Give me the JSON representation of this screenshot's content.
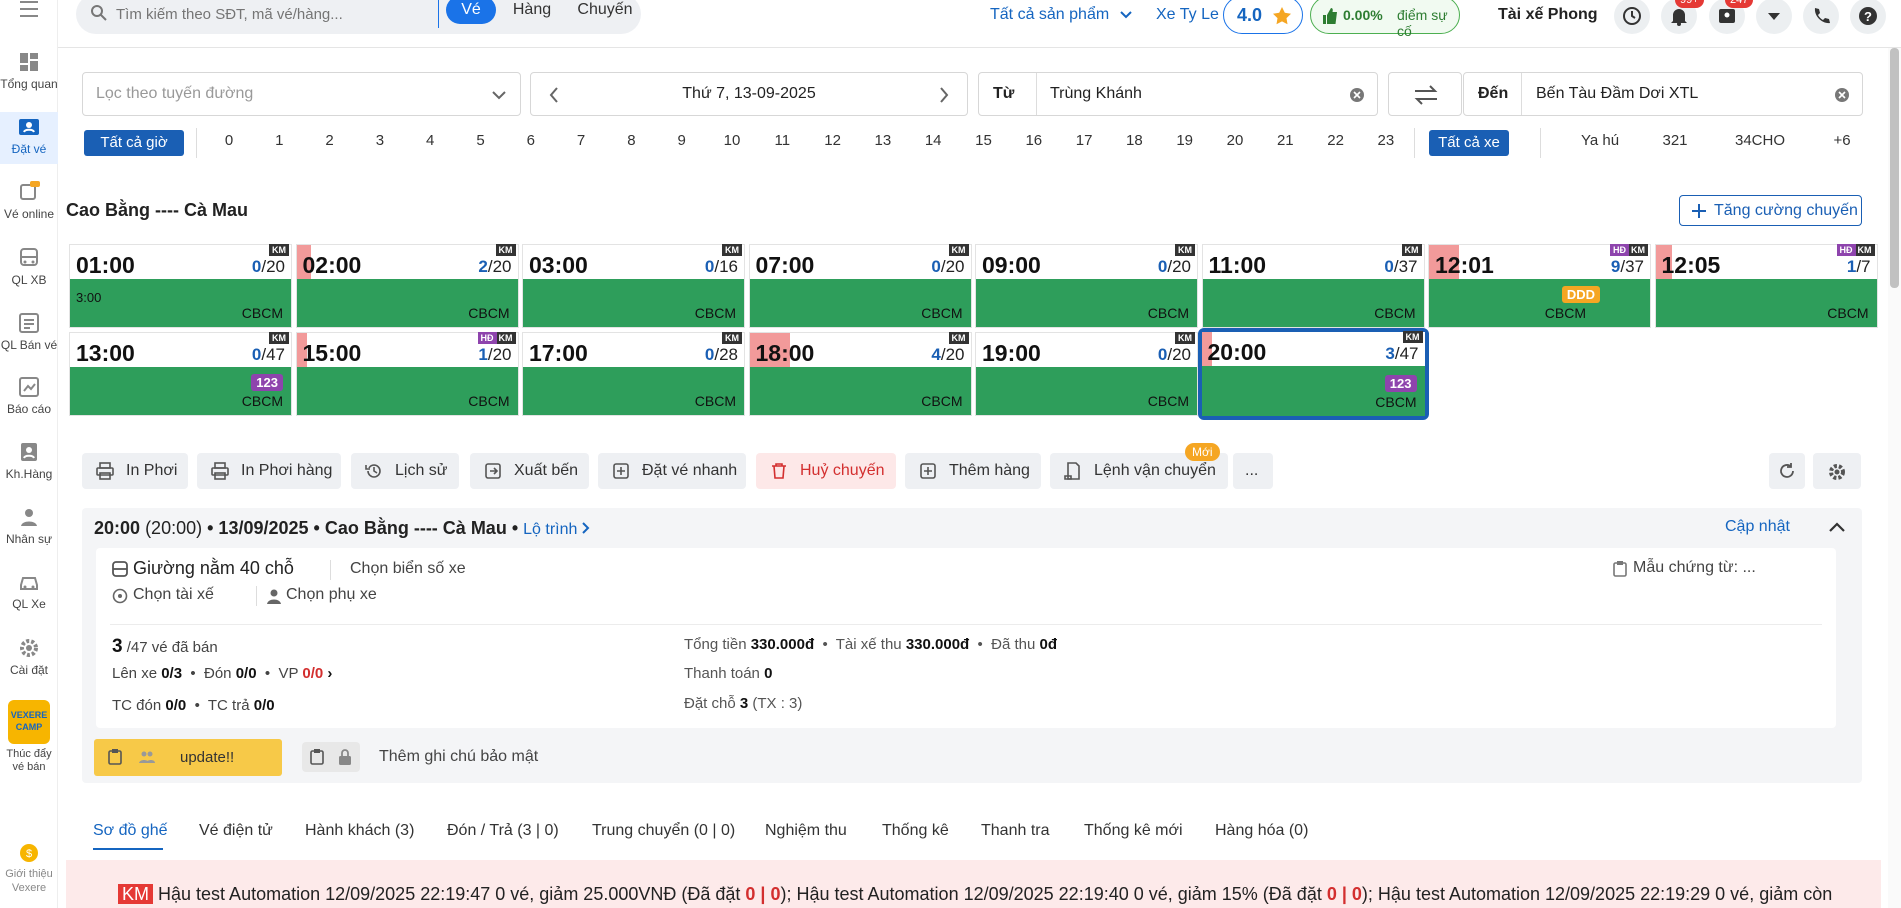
{
  "topbar": {
    "search_placeholder": "Tìm kiếm theo SĐT, mã vé/hàng...",
    "seg_tabs": [
      "Vé",
      "Hàng",
      "Chuyến"
    ],
    "products": "Tất cả sản phẩm",
    "company": "Xe Ty Le",
    "rating": "4.0",
    "incident": "0.00%",
    "incident_label": "điểm sự cố",
    "user": "Tài xế Phong",
    "notif_badge": "99+",
    "user_badge": "247"
  },
  "sidebar": {
    "items": [
      "Tổng quan",
      "Đặt vé",
      "Vé online",
      "QL XB",
      "QL Bán vé",
      "Báo cáo",
      "Kh.Hàng",
      "Nhân sự",
      "QL Xe",
      "Cài đặt",
      "Thúc đẩy vé bán",
      "Giới thiệu Vexere"
    ],
    "camp_text": "VEXERE CAMP"
  },
  "filters": {
    "route_placeholder": "Lọc theo tuyến đường",
    "date": "Thứ 7, 13-09-2025",
    "from_label": "Từ",
    "from_value": "Trùng Khánh",
    "to_label": "Đến",
    "to_value": "Bến Tàu Đầm Dơi XTL",
    "all_hours": "Tất cả giờ",
    "hours": [
      "0",
      "1",
      "2",
      "3",
      "4",
      "5",
      "6",
      "7",
      "8",
      "9",
      "10",
      "11",
      "12",
      "13",
      "14",
      "15",
      "16",
      "17",
      "18",
      "19",
      "20",
      "21",
      "22",
      "23"
    ],
    "all_vehicles": "Tất cả xe",
    "vehicles": [
      "Ya hú",
      "321",
      "34CHO",
      "+6"
    ]
  },
  "route": {
    "title": "Cao Bằng ---- Cà Mau",
    "boost_button": "Tăng cường chuyến"
  },
  "trips": [
    {
      "time": "01:00",
      "sold": "0",
      "total": "/20",
      "tag": "CBCM",
      "sub": "3:00"
    },
    {
      "time": "02:00",
      "sold": "2",
      "total": "/20",
      "tag": "CBCM"
    },
    {
      "time": "03:00",
      "sold": "0",
      "total": "/16",
      "tag": "CBCM"
    },
    {
      "time": "07:00",
      "sold": "0",
      "total": "/20",
      "tag": "CBCM"
    },
    {
      "time": "09:00",
      "sold": "0",
      "total": "/20",
      "tag": "CBCM"
    },
    {
      "time": "11:00",
      "sold": "0",
      "total": "/37",
      "tag": "CBCM"
    },
    {
      "time": "12:01",
      "sold": "9",
      "total": "/37",
      "tag": "CBCM",
      "badge": "DDD"
    },
    {
      "time": "12:05",
      "sold": "1",
      "total": "/7",
      "tag": "CBCM"
    },
    {
      "time": "13:00",
      "sold": "0",
      "total": "/47",
      "tag": "CBCM",
      "badge": "123"
    },
    {
      "time": "15:00",
      "sold": "1",
      "total": "/20",
      "tag": "CBCM"
    },
    {
      "time": "17:00",
      "sold": "0",
      "total": "/28",
      "tag": "CBCM"
    },
    {
      "time": "18:00",
      "sold": "4",
      "total": "/20",
      "tag": "CBCM"
    },
    {
      "time": "19:00",
      "sold": "0",
      "total": "/20",
      "tag": "CBCM"
    },
    {
      "time": "20:00",
      "sold": "3",
      "total": "/47",
      "tag": "CBCM",
      "badge": "123"
    }
  ],
  "trip_labels": {
    "km": "KM",
    "hd": "HĐ"
  },
  "actions": [
    "In Phơi",
    "In Phơi hàng",
    "Lịch sử",
    "Xuất bến",
    "Đặt vé nhanh",
    "Huỷ chuyến",
    "Thêm hàng",
    "Lệnh vận chuyển",
    "..."
  ],
  "new_badge": "Mới",
  "trip_info": {
    "header_time": "20:00",
    "header_paren": "(20:00)",
    "header_rest": "• 13/09/2025 • Cao Bằng ---- Cà Mau •",
    "route_link": "Lộ trình",
    "update_link": "Cập nhật",
    "bus_type": "Giường nằm 40 chỗ",
    "plate": "Chọn biển số xe",
    "driver": "Chọn tài xế",
    "assistant": "Chọn phụ xe",
    "receipt": "Mẫu chứng từ: ...",
    "sold": "3",
    "sold_rest": "/47 vé đã bán",
    "board_label": "Lên xe",
    "board_val": "0/3",
    "pickup_label": "Đón",
    "pickup_val": "0/0",
    "vp_label": "VP",
    "vp_val": "0/0",
    "tc_pick_label": "TC đón",
    "tc_pick_val": "0/0",
    "tc_drop_label": "TC trả",
    "tc_drop_val": "0/0",
    "total_label": "Tổng tiền",
    "total_val": "330.000đ",
    "driver_collect_label": "Tài xế thu",
    "driver_collect_val": "330.000đ",
    "collected_label": "Đã thu",
    "collected_val": "0đ",
    "payment_label": "Thanh toán",
    "payment_val": "0",
    "reserve_label": "Đặt chỗ",
    "reserve_val": "3",
    "reserve_tx": "(TX : 3)",
    "note": "update!!",
    "secure_note": "Thêm ghi chú bảo mật"
  },
  "tabs": [
    "Sơ đồ ghế",
    "Vé điện tử",
    "Hành khách (3)",
    "Đón / Trả (3 | 0)",
    "Trung chuyển (0 | 0)",
    "Nghiệm thu",
    "Thống kê",
    "Thanh tra",
    "Thống kê mới",
    "Hàng hóa (0)"
  ],
  "promo": {
    "tag": "KM",
    "p1": "Hậu test Automation 12/09/2025 22:19:47 0 vé, giảm 25.000VNĐ (Đã đặt",
    "p1v": "0 | 0",
    "p2": "); Hậu test Automation 12/09/2025 22:19:40 0 vé, giảm 15% (Đã đặt",
    "p2v": "0 | 0",
    "p3": "); Hậu test Automation 12/09/2025 22:19:29 0 vé, giảm còn"
  },
  "colors": {
    "primary": "#1a5fb4",
    "green": "#2e9e5b",
    "danger": "#d32f2f"
  }
}
